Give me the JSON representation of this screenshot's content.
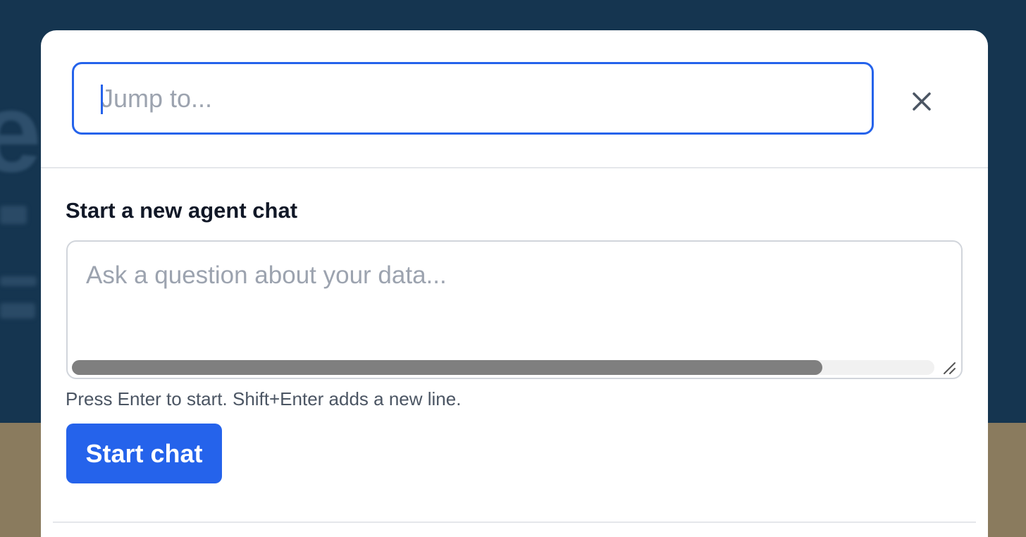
{
  "search": {
    "placeholder": "Jump to...",
    "value": ""
  },
  "close_icon": "close-icon",
  "new_chat": {
    "title": "Start a new agent chat",
    "input_placeholder": "Ask a question about your data...",
    "input_value": "",
    "hint": "Press Enter to start. Shift+Enter adds a new line.",
    "button_label": "Start chat",
    "horizontal_scroll_position": 0.87
  },
  "colors": {
    "accent": "#2563eb",
    "backdrop": "#153550",
    "modal_bg": "#ffffff",
    "title_text": "#111827",
    "muted_text": "#4b5563"
  }
}
